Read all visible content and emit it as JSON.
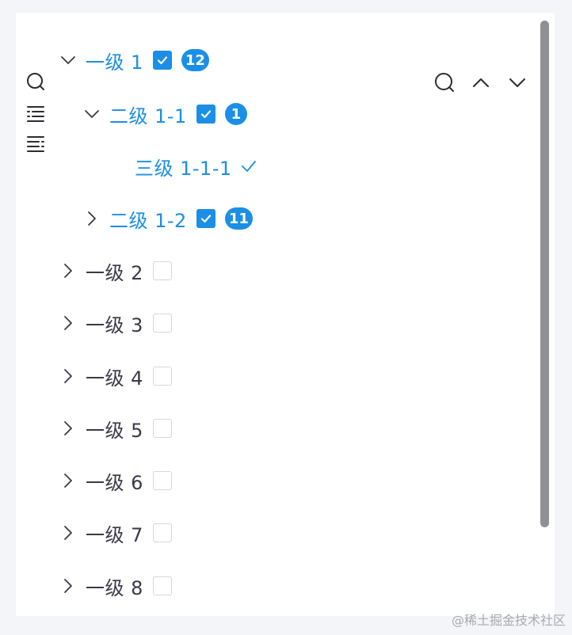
{
  "tree": {
    "nodes": [
      {
        "label": "一级 1",
        "badge": "12"
      },
      {
        "label": "二级 1-1",
        "badge": "1"
      },
      {
        "label": "三级 1-1-1"
      },
      {
        "label": "二级 1-2",
        "badge": "11"
      },
      {
        "label": "一级 2"
      },
      {
        "label": "一级 3"
      },
      {
        "label": "一级 4"
      },
      {
        "label": "一级 5"
      },
      {
        "label": "一级 6"
      },
      {
        "label": "一级 7"
      },
      {
        "label": "一级 8"
      }
    ]
  },
  "colors": {
    "accent": "#1b8fe6",
    "text": "#3a3a48",
    "border": "#d6d7dc"
  },
  "watermark": "@稀土掘金技术社区"
}
